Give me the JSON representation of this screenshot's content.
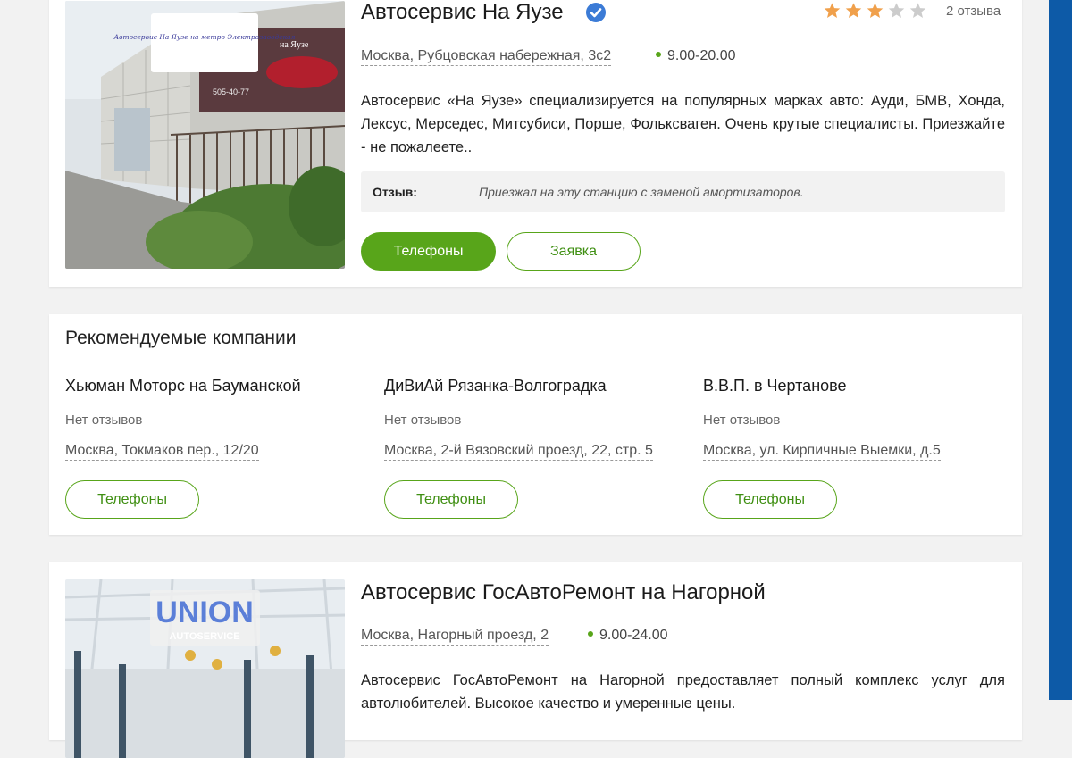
{
  "listing1": {
    "photo_sign": "Автосервис На Яузе на метро Электрозаводская",
    "photo_banner_text": "на Яузе",
    "photo_phone": "505-40-77",
    "title": "Автосервис На Яузе",
    "rating": 3,
    "rating_max": 5,
    "reviews_count": "2 отзыва",
    "address": "Москва, Рубцовская набережная, 3с2",
    "hours": "9.00-20.00",
    "description": "Автосервис «На Яузе» специализируется на популярных марках авто: Ауди, БМВ, Хонда, Лексус, Мерседес, Митсубиси, Порше, Фольксваген. Очень крутые специалисты. Приезжайте - не пожалеете..",
    "review_label": "Отзыв:",
    "review_text": "Приезжал на эту станцию с заменой амортизаторов.",
    "phones_label": "Телефоны",
    "request_label": "Заявка"
  },
  "recommended": {
    "title": "Рекомендуемые компании",
    "items": [
      {
        "name": "Хьюман Моторс на Бауманской",
        "reviews": "Нет отзывов",
        "address": "Москва, Токмаков пер., 12/20",
        "phones_label": "Телефоны"
      },
      {
        "name": "ДиВиАй Рязанка-Волгоградка",
        "reviews": "Нет отзывов",
        "address": "Москва, 2-й Вязовский проезд, 22, стр. 5",
        "phones_label": "Телефоны"
      },
      {
        "name": "В.В.П. в Чертанове",
        "reviews": "Нет отзывов",
        "address": "Москва, ул. Кирпичные Выемки, д.5",
        "phones_label": "Телефоны"
      }
    ]
  },
  "listing2": {
    "photo_logo": "UNION",
    "photo_logo_sub": "AUTOSERVICE",
    "title": "Автосервис ГосАвтоРемонт на Нагорной",
    "address": "Москва, Нагорный проезд, 2",
    "hours": "9.00-24.00",
    "description": "Автосервис ГосАвтоРемонт на Нагорной предоставляет полный комплекс услуг для автолюбителей. Высокое качество и умеренные цены."
  },
  "colors": {
    "accent_green": "#58a51a",
    "star_filled": "#f0a04b",
    "star_empty": "#cccccc",
    "verified_blue": "#3b7bd6",
    "side_bar_blue": "#0d5aa7"
  }
}
